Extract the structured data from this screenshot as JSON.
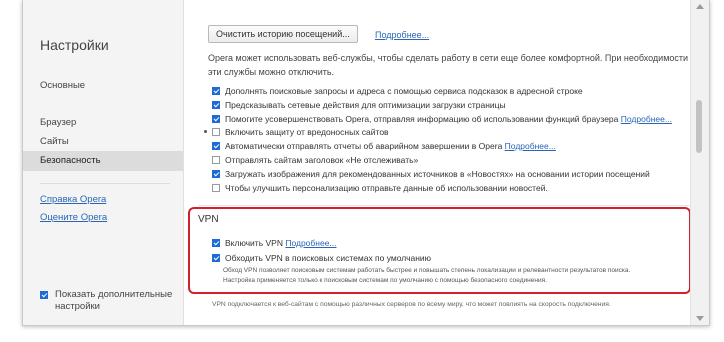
{
  "sidebar": {
    "title": "Настройки",
    "items": [
      {
        "label": "Основные"
      },
      {
        "label": "Браузер"
      },
      {
        "label": "Сайты"
      },
      {
        "label": "Безопасность"
      }
    ],
    "links": [
      {
        "label": "Справка Opera"
      },
      {
        "label": "Оцените Opera"
      }
    ],
    "advanced": {
      "label": "Показать дополнительные настройки",
      "checked": true
    }
  },
  "main": {
    "clear_history_button": "Очистить историю посещений...",
    "more_link": "Подробнее...",
    "description": "Opera может использовать веб-службы, чтобы сделать работу в сети еще более комфортной. При необходимости эти службы можно отключить.",
    "options": [
      {
        "label": "Дополнять поисковые запросы и адреса с помощью сервиса подсказок в адресной строке",
        "checked": true,
        "link": ""
      },
      {
        "label": "Предсказывать сетевые действия для оптимизации загрузки страницы",
        "checked": true,
        "link": ""
      },
      {
        "label": "Помогите усовершенствовать Opera, отправляя информацию об использовании функций браузера",
        "checked": true,
        "link": "Подробнее..."
      },
      {
        "label": "Включить защиту от вредоносных сайтов",
        "checked": false,
        "link": ""
      },
      {
        "label": "Автоматически отправлять отчеты об аварийном завершении в Opera",
        "checked": true,
        "link": "Подробнее..."
      },
      {
        "label": "Отправлять сайтам заголовок «Не отслеживать»",
        "checked": false,
        "link": ""
      },
      {
        "label": "Загружать изображения для рекомендованных источников в «Новостях» на основании истории посещений",
        "checked": true,
        "link": ""
      },
      {
        "label": "Чтобы улучшить персонализацию отправьте данные об использовании новостей.",
        "checked": false,
        "link": ""
      }
    ],
    "vpn": {
      "title": "VPN",
      "enable_label": "Включить VPN",
      "enable_link": "Подробнее...",
      "enable_checked": true,
      "bypass_label": "Обходить VPN в поисковых системах по умолчанию",
      "bypass_checked": true,
      "bypass_note_1": "Обход VPN позволяет поисковым системам работать быстрее и повышать степень локализации и релевантности результатов поиска.",
      "bypass_note_2": "Настройка применяется только к поисковым системам по умолчанию с помощью безопасного соединения.",
      "footer": "VPN подключается к веб-сайтам с помощью различных серверов по всему миру, что может повлиять на скорость подключения."
    }
  },
  "colors": {
    "accent": "#1e6bd6",
    "highlight": "#d0212f",
    "link": "#2a66b5"
  }
}
